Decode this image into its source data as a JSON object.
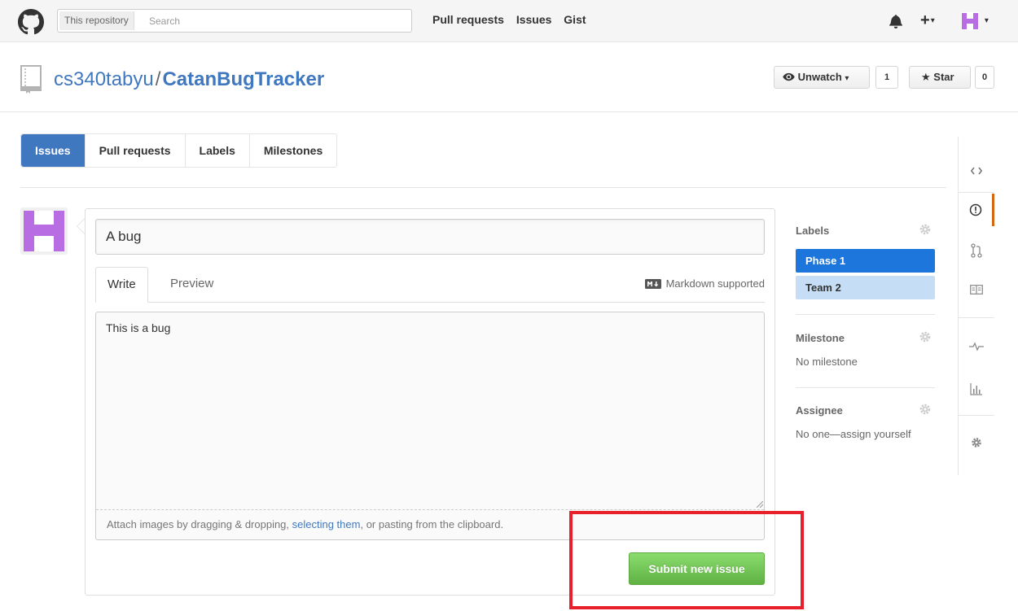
{
  "header": {
    "search_scope": "This repository",
    "search_placeholder": "Search",
    "nav": [
      "Pull requests",
      "Issues",
      "Gist"
    ]
  },
  "repo": {
    "owner": "cs340tabyu",
    "separator": "/",
    "name": "CatanBugTracker",
    "watch_label": "Unwatch",
    "watch_count": "1",
    "star_label": "Star",
    "star_count": "0"
  },
  "subnav": {
    "items": [
      "Issues",
      "Pull requests",
      "Labels",
      "Milestones"
    ],
    "active": "Issues"
  },
  "issue_form": {
    "title_value": "A bug",
    "tabs": [
      "Write",
      "Preview"
    ],
    "markdown_note": "Markdown supported",
    "body_value": "This is a bug",
    "attach_text_before": "Attach images by dragging & dropping, ",
    "attach_link": "selecting them",
    "attach_text_after": ", or pasting from the clipboard.",
    "submit_label": "Submit new issue"
  },
  "sidebar": {
    "labels_title": "Labels",
    "labels": [
      {
        "name": "Phase 1",
        "bg": "#1d76db",
        "fg": "#ffffff"
      },
      {
        "name": "Team 2",
        "bg": "#c5def5",
        "fg": "#333333"
      }
    ],
    "milestone_title": "Milestone",
    "milestone_value": "No milestone",
    "assignee_title": "Assignee",
    "assignee_value": "No one—assign yourself"
  },
  "repo_nav_icons": [
    "code-icon",
    "issue-opened-icon",
    "pull-request-icon",
    "wiki-book-icon",
    "pulse-icon",
    "graph-icon",
    "settings-gear-icon"
  ],
  "colors": {
    "accent_blue": "#4078c0",
    "submit_green": "#60b044",
    "avatar_purple": "#b86de2",
    "highlight_red": "#e8202c",
    "selected_nav_orange": "#d26911"
  }
}
